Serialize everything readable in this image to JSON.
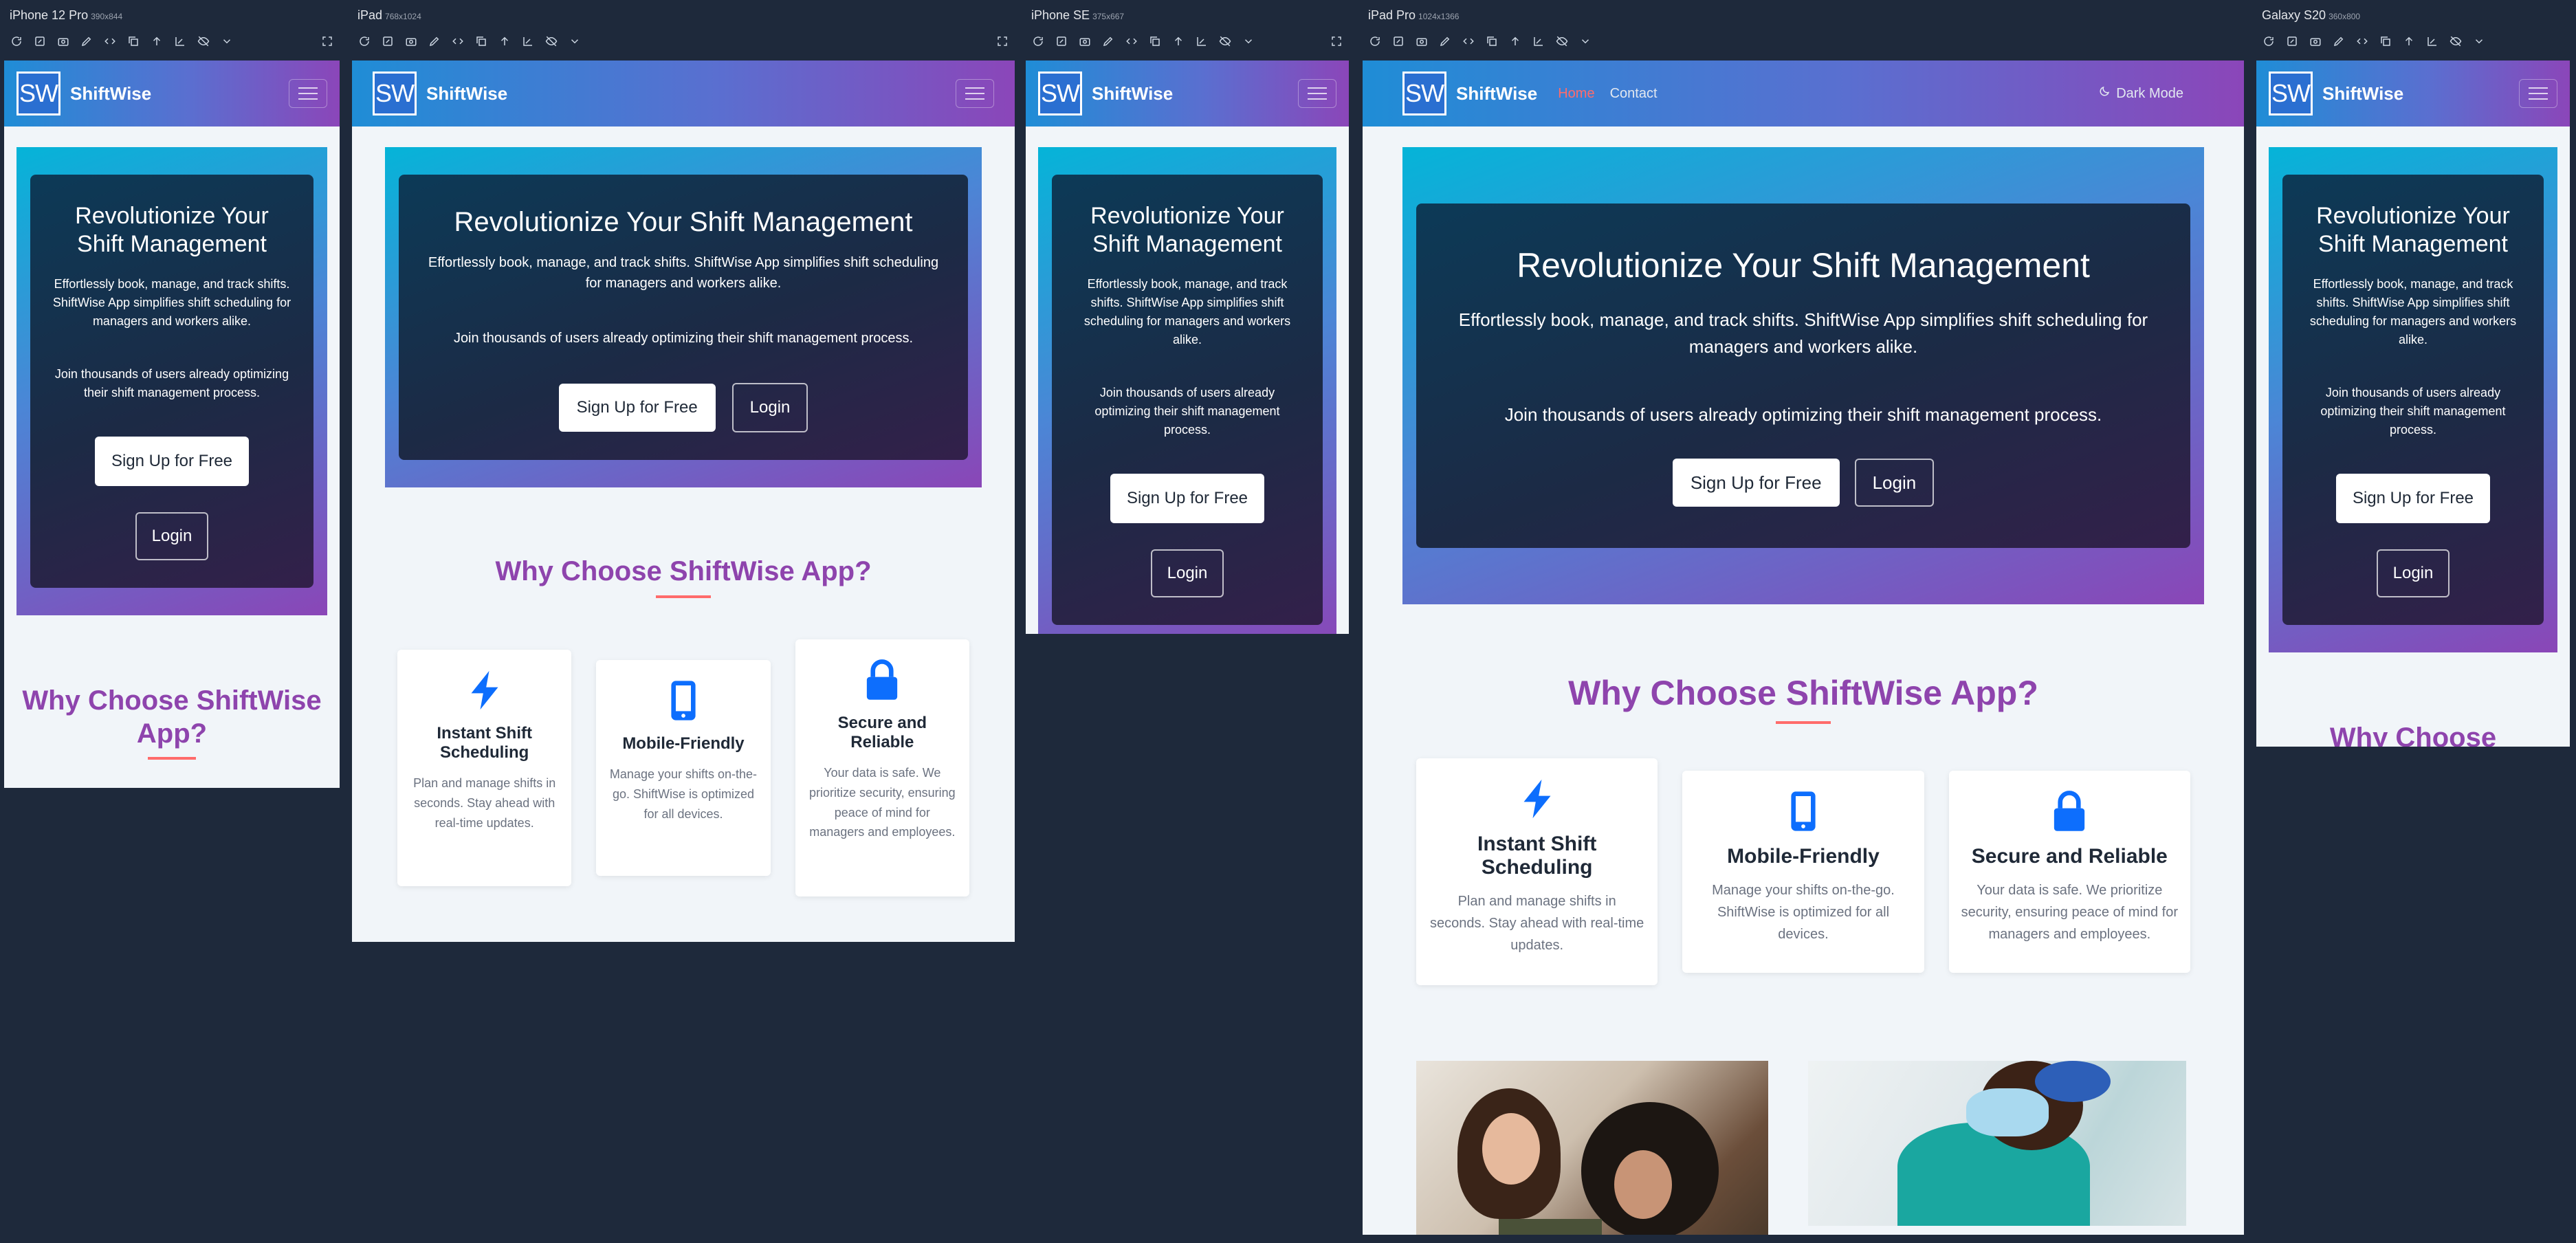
{
  "app": {
    "brand": "ShiftWise",
    "logo_text": "SW"
  },
  "frames": {
    "iphone12": {
      "device": "iPhone 12 Pro",
      "size": "390x844"
    },
    "ipad": {
      "device": "iPad",
      "size": "768x1024"
    },
    "iphonese": {
      "device": "iPhone SE",
      "size": "375x667"
    },
    "ipadpro": {
      "device": "iPad Pro",
      "size": "1024x1366"
    },
    "galaxy": {
      "device": "Galaxy S20",
      "size": "360x800"
    }
  },
  "nav": {
    "links": {
      "home": "Home",
      "contact": "Contact"
    },
    "dark_mode": "Dark Mode"
  },
  "hero": {
    "title": "Revolutionize Your Shift Management",
    "subtitle": "Effortlessly book, manage, and track shifts. ShiftWise App simplifies shift scheduling for managers and workers alike.",
    "join": "Join thousands of users already optimizing their shift management process.",
    "signup_label": "Sign Up for Free",
    "login_label": "Login"
  },
  "why": {
    "title": "Why Choose ShiftWise App?",
    "title_short": "Why Choose"
  },
  "features": [
    {
      "icon": "lightning-icon",
      "title": "Instant Shift Scheduling",
      "desc": "Plan and manage shifts in seconds. Stay ahead with real-time updates."
    },
    {
      "icon": "mobile-icon",
      "title": "Mobile-Friendly",
      "desc": "Manage your shifts on-the-go. ShiftWise is optimized for all devices."
    },
    {
      "icon": "lock-icon",
      "title": "Secure and Reliable",
      "desc": "Your data is safe. We prioritize security, ensuring peace of mind for managers and employees."
    }
  ],
  "colors": {
    "accent_purple": "#8e44ad",
    "accent_coral": "#ff6b6b",
    "icon_blue": "#0d6efd",
    "page_bg": "#1e293b"
  }
}
